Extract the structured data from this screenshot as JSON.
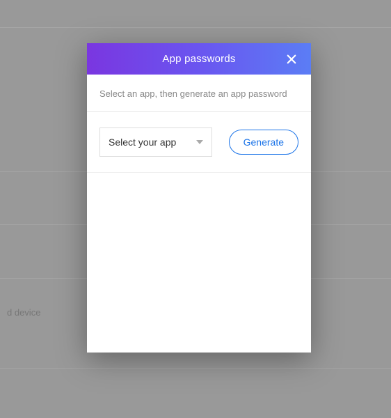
{
  "background": {
    "visible_text": "d device"
  },
  "modal": {
    "title": "App passwords",
    "subtitle": "Select an app, then generate an app password",
    "select_label": "Select your app",
    "generate_label": "Generate"
  }
}
